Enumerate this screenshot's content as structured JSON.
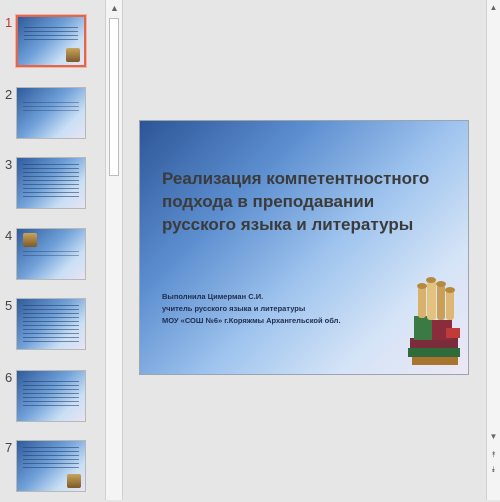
{
  "thumbnails": [
    {
      "number": "1",
      "active": true
    },
    {
      "number": "2",
      "active": false
    },
    {
      "number": "3",
      "active": false
    },
    {
      "number": "4",
      "active": false
    },
    {
      "number": "5",
      "active": false
    },
    {
      "number": "6",
      "active": false
    },
    {
      "number": "7",
      "active": false
    }
  ],
  "slide": {
    "title_line1": "Реализация компетентностного",
    "title_line2": "подхода в преподавании",
    "title_line3": "русского языка и литературы",
    "author_line1": "Выполнила Цимерман С.И.",
    "author_line2": "учитель русского языка и литературы",
    "author_line3": "МОУ «СОШ №6» г.Коряжмы Архангельской обл."
  },
  "icons": {
    "scroll_up": "▲",
    "scroll_down": "▼",
    "prev_slide": "⯭",
    "next_slide": "⯯"
  },
  "colors": {
    "active_thumb_border": "#e0674b",
    "active_number": "#c0392b"
  }
}
